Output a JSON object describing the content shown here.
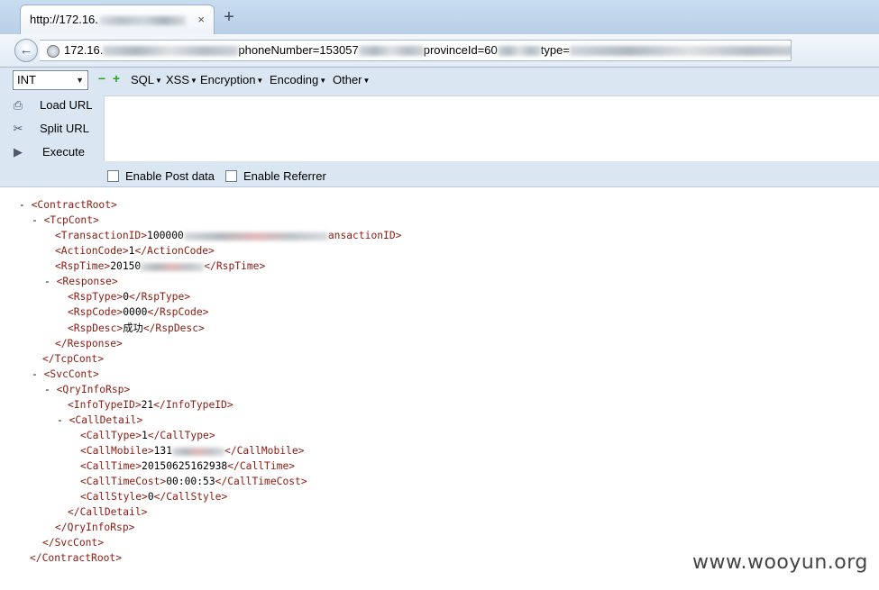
{
  "browser": {
    "tab_title": "http://172.16.",
    "tab_close": "×",
    "new_tab": "+",
    "url": {
      "part1": "172.16.",
      "part2": "phoneNumber=153057",
      "part3": "provinceId=60",
      "part4": "type="
    }
  },
  "hackbar": {
    "select_value": "INT",
    "remove_label": "−",
    "add_label": "+",
    "menus": [
      "SQL",
      "XSS",
      "Encryption",
      "Encoding",
      "Other"
    ],
    "load_url": "Load URL",
    "split_url": "Split URL",
    "execute": "Execute",
    "enable_post": "Enable Post data",
    "enable_referrer": "Enable Referrer"
  },
  "xml": {
    "contract_root": "ContractRoot",
    "tcp_cont": "TcpCont",
    "transaction_id_prefix": "100000",
    "transaction_close_partial": "ansactionID",
    "action_code": "1",
    "rsp_time_prefix": "20150",
    "response": "Response",
    "rsp_type": "0",
    "rsp_code": "0000",
    "rsp_desc": "成功",
    "svc_cont": "SvcCont",
    "qry_info_rsp": "QryInfoRsp",
    "info_type_id": "21",
    "call_detail": "CallDetail",
    "call_type": "1",
    "call_mobile_prefix": "131",
    "call_time": "20150625162938",
    "call_time_cost": "00:00:53",
    "call_style": "0"
  },
  "watermark": "www.wooyun.org"
}
